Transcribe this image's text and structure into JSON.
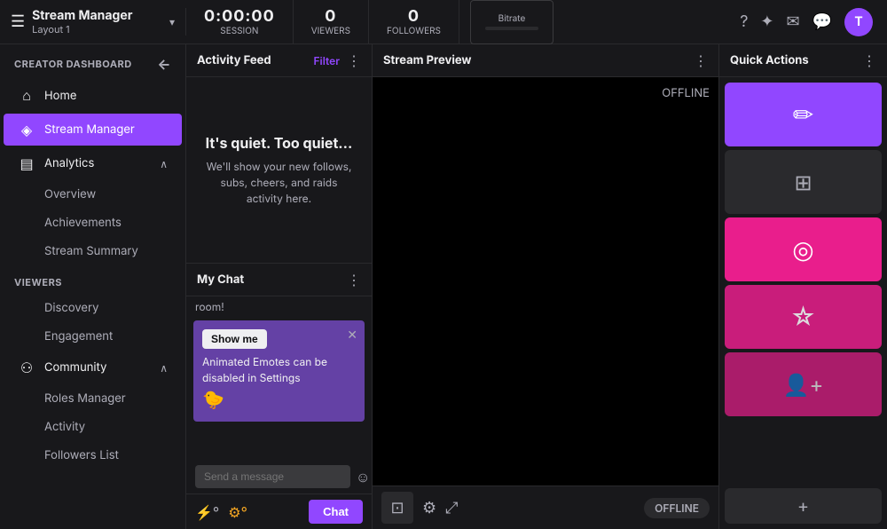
{
  "topbar": {
    "app_title": "Stream Manager",
    "layout_label": "Layout 1",
    "session_value": "0:00:00",
    "session_label": "Session",
    "viewers_value": "0",
    "viewers_label": "Viewers",
    "followers_value": "0",
    "followers_label": "Followers",
    "bitrate_label": "Bitrate"
  },
  "sidebar": {
    "section_label": "CREATOR DASHBOARD",
    "back_label": "←",
    "items": [
      {
        "id": "home",
        "icon": "⌂",
        "label": "Home",
        "active": false
      },
      {
        "id": "stream-manager",
        "icon": "◈",
        "label": "Stream Manager",
        "active": true
      },
      {
        "id": "analytics",
        "icon": "▤",
        "label": "Analytics",
        "active": false,
        "chevron": "∧"
      }
    ],
    "analytics_sub": [
      {
        "label": "Overview"
      },
      {
        "label": "Achievements"
      },
      {
        "label": "Stream Summary"
      }
    ],
    "viewers_label": "VIEWERS",
    "viewers_items": [
      {
        "label": "Discovery"
      },
      {
        "label": "Engagement"
      }
    ],
    "community_item": {
      "icon": "⚇",
      "label": "Community",
      "chevron": "∧"
    },
    "community_sub": [
      {
        "label": "Roles Manager"
      },
      {
        "label": "Activity"
      },
      {
        "label": "Followers List"
      }
    ]
  },
  "activity_feed": {
    "title": "Activity Feed",
    "filter_label": "Filter",
    "empty_title": "It's quiet. Too quiet...",
    "empty_desc": "We'll show your new follows, subs, cheers, and raids activity here."
  },
  "my_chat": {
    "title": "My Chat",
    "room_text": "room!",
    "notification": {
      "text": "Animated Emotes can be disabled in Settings",
      "show_me_label": "Show me",
      "emoji": "🐤"
    },
    "send_placeholder": "Send a message",
    "chat_label": "Chat",
    "offline_status": "OFFLINE"
  },
  "stream_preview": {
    "title": "Stream Preview",
    "offline_text": "OFFLINE"
  },
  "quick_actions": {
    "title": "Quick Actions",
    "add_label": "+"
  }
}
